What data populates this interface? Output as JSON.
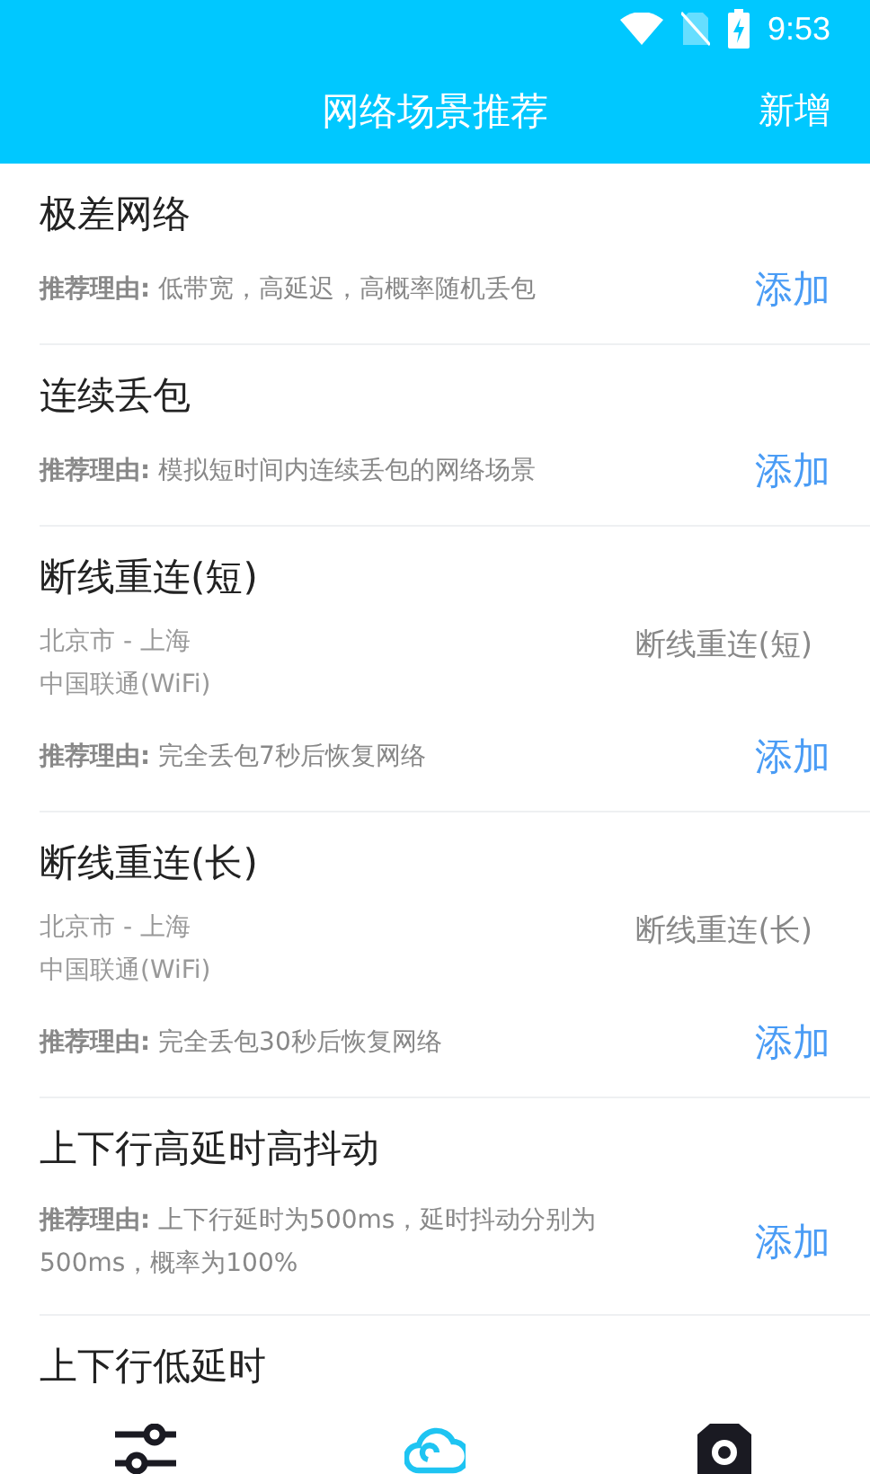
{
  "status_bar": {
    "time": "9:53"
  },
  "header": {
    "title": "网络场景推荐",
    "action": "新增"
  },
  "scenarios": [
    {
      "title": "极差网络",
      "reason_label": "推荐理由:",
      "reason": "低带宽，高延迟，高概率随机丢包",
      "action": "添加"
    },
    {
      "title": "连续丢包",
      "reason_label": "推荐理由:",
      "reason": "模拟短时间内连续丢包的网络场景",
      "action": "添加"
    },
    {
      "title": "断线重连(短)",
      "location": "北京市 - 上海",
      "carrier": "中国联通(WiFi)",
      "scenario": "断线重连(短)",
      "reason_label": "推荐理由:",
      "reason": "完全丢包7秒后恢复网络",
      "action": "添加"
    },
    {
      "title": "断线重连(长)",
      "location": "北京市 - 上海",
      "carrier": "中国联通(WiFi)",
      "scenario": "断线重连(长)",
      "reason_label": "推荐理由:",
      "reason": "完全丢包30秒后恢复网络",
      "action": "添加"
    },
    {
      "title": "上下行高延时高抖动",
      "reason_label": "推荐理由:",
      "reason": "上下行延时为500ms，延时抖动分别为500ms，概率为100%",
      "action": "添加"
    },
    {
      "title": "上下行低延时"
    }
  ],
  "bottom_nav": [
    {
      "kind": "sliders",
      "selected": false
    },
    {
      "kind": "cloud",
      "selected": true
    },
    {
      "kind": "camera",
      "selected": false
    }
  ]
}
